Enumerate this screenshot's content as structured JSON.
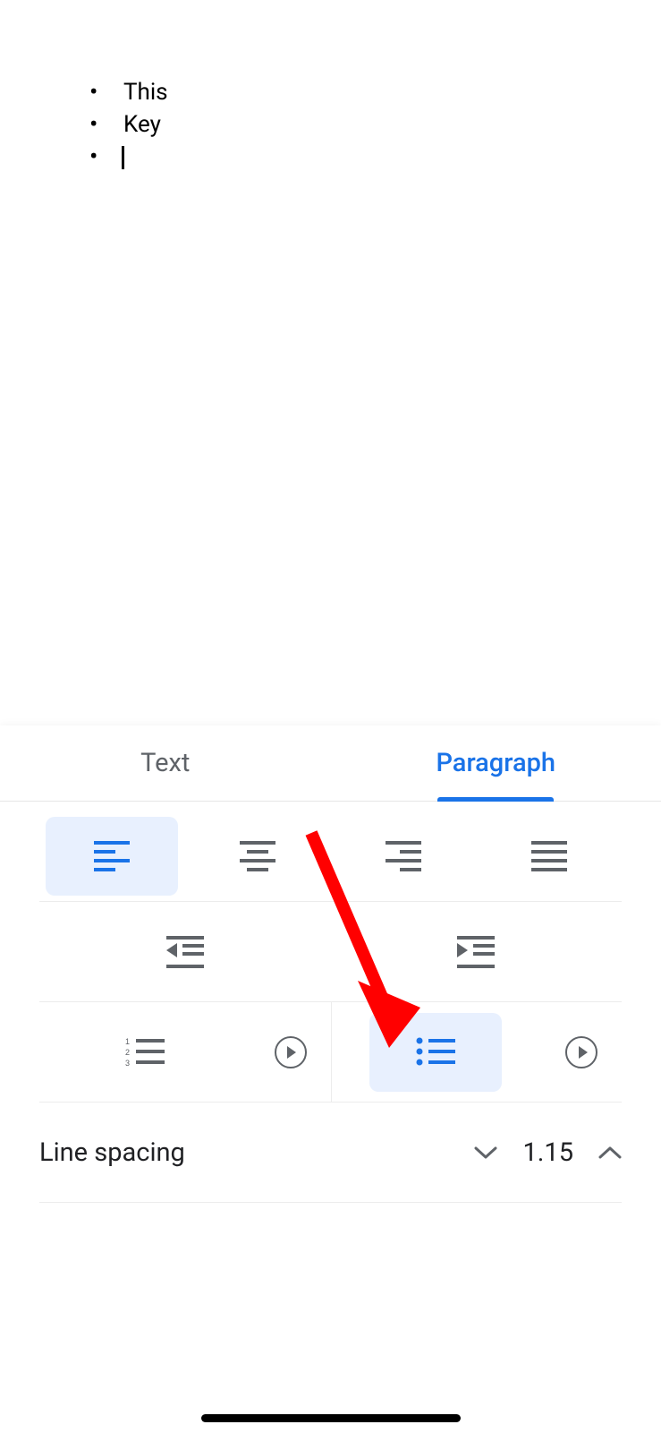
{
  "document": {
    "bullets": [
      "This",
      "Key",
      ""
    ]
  },
  "tabs": {
    "text": "Text",
    "paragraph": "Paragraph",
    "active": "paragraph"
  },
  "alignment": {
    "options": [
      "left",
      "center",
      "right",
      "justify"
    ],
    "selected": "left"
  },
  "indent": {
    "options": [
      "decrease",
      "increase"
    ]
  },
  "lists": {
    "numbered_selected": false,
    "bulleted_selected": true
  },
  "line_spacing": {
    "label": "Line spacing",
    "value": "1.15"
  },
  "annotation": {
    "type": "red-arrow",
    "points_to": "bulleted-list-button"
  }
}
